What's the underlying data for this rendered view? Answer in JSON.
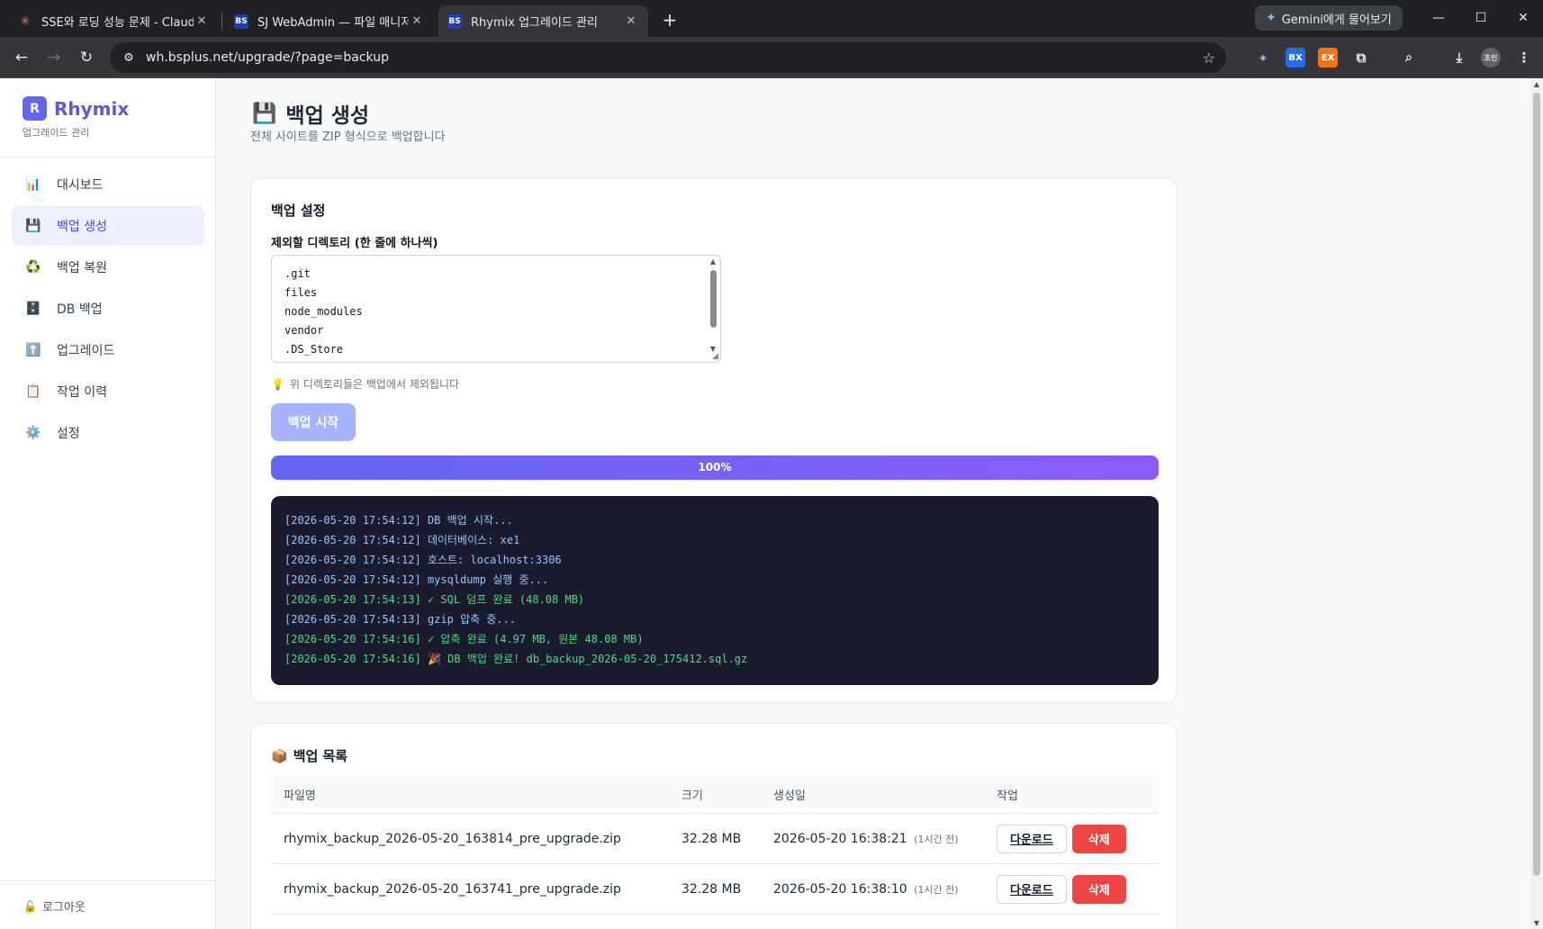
{
  "browser": {
    "tabs": [
      {
        "title": "SSE와 로딩 성능 문제 - Claude",
        "favicon": "claude-icon"
      },
      {
        "title": "SJ WebAdmin — 파일 매니저",
        "favicon": "bs-icon"
      },
      {
        "title": "Rhymix 업그레이드 관리",
        "favicon": "bs-icon"
      }
    ],
    "gemini_label": "Gemini에게 물어보기",
    "url": "wh.bsplus.net/upgrade/?page=backup",
    "extensions": [
      "shield-icon",
      "bx-icon",
      "ex-icon",
      "puzzle-icon",
      "search-tab-icon",
      "download-icon",
      "profile-avatar"
    ],
    "profile_label": "조인"
  },
  "sidebar": {
    "brand_letter": "R",
    "brand_name": "Rhymix",
    "brand_sub": "업그레이드 관리",
    "items": [
      {
        "icon": "📊",
        "label": "대시보드"
      },
      {
        "icon": "💾",
        "label": "백업 생성"
      },
      {
        "icon": "♻️",
        "label": "백업 복원"
      },
      {
        "icon": "🗄️",
        "label": "DB 백업"
      },
      {
        "icon": "⬆️",
        "label": "업그레이드"
      },
      {
        "icon": "📋",
        "label": "작업 이력"
      },
      {
        "icon": "⚙️",
        "label": "설정"
      }
    ],
    "active_index": 1,
    "logout_icon": "🔓",
    "logout_label": "로그아웃"
  },
  "page": {
    "title_icon": "💾",
    "title": "백업 생성",
    "subtitle": "전체 사이트를 ZIP 형식으로 백업합니다"
  },
  "settings": {
    "title": "백업 설정",
    "field_label": "제외할 디렉토리 (한 줄에 하나씩)",
    "excluded_dirs": [
      ".git",
      "files",
      "node_modules",
      "vendor",
      ".DS_Store"
    ],
    "hint_icon": "💡",
    "hint": "위 디렉토리들은 백업에서 제외됩니다",
    "start_button": "백업 시작",
    "progress_percent": 100,
    "progress_label": "100%"
  },
  "log": [
    {
      "text": "[2026-05-20 17:54:12] DB 백업 시작...",
      "type": "info"
    },
    {
      "text": "[2026-05-20 17:54:12] 데이터베이스: xe1",
      "type": "info"
    },
    {
      "text": "[2026-05-20 17:54:12] 호스트: localhost:3306",
      "type": "info"
    },
    {
      "text": "[2026-05-20 17:54:12] mysqldump 실행 중...",
      "type": "info"
    },
    {
      "text": "[2026-05-20 17:54:13] ✓ SQL 덤프 완료 (48.08 MB)",
      "type": "ok"
    },
    {
      "text": "[2026-05-20 17:54:13] gzip 압축 중...",
      "type": "info"
    },
    {
      "text": "[2026-05-20 17:54:16] ✓ 압축 완료 (4.97 MB, 원본 48.08 MB)",
      "type": "ok"
    },
    {
      "text": "[2026-05-20 17:54:16] 🎉 DB 백업 완료! db_backup_2026-05-20_175412.sql.gz",
      "type": "ok"
    }
  ],
  "backups": {
    "title_icon": "📦",
    "title": "백업 목록",
    "columns": [
      "파일명",
      "크기",
      "생성일",
      "작업"
    ],
    "rows": [
      {
        "file": "rhymix_backup_2026-05-20_163814_pre_upgrade.zip",
        "size": "32.28 MB",
        "date": "2026-05-20 16:38:21",
        "relative": "(1시간 전)"
      },
      {
        "file": "rhymix_backup_2026-05-20_163741_pre_upgrade.zip",
        "size": "32.28 MB",
        "date": "2026-05-20 16:38:10",
        "relative": "(1시간 전)"
      }
    ],
    "download_label": "다운로드",
    "delete_label": "삭제"
  },
  "colors": {
    "accent": "#6366f1",
    "accent_light": "#a5b4fc",
    "danger": "#ef4444",
    "console_bg": "#1a1b2e",
    "log_info": "#93c5fd",
    "log_ok": "#4ade80"
  }
}
